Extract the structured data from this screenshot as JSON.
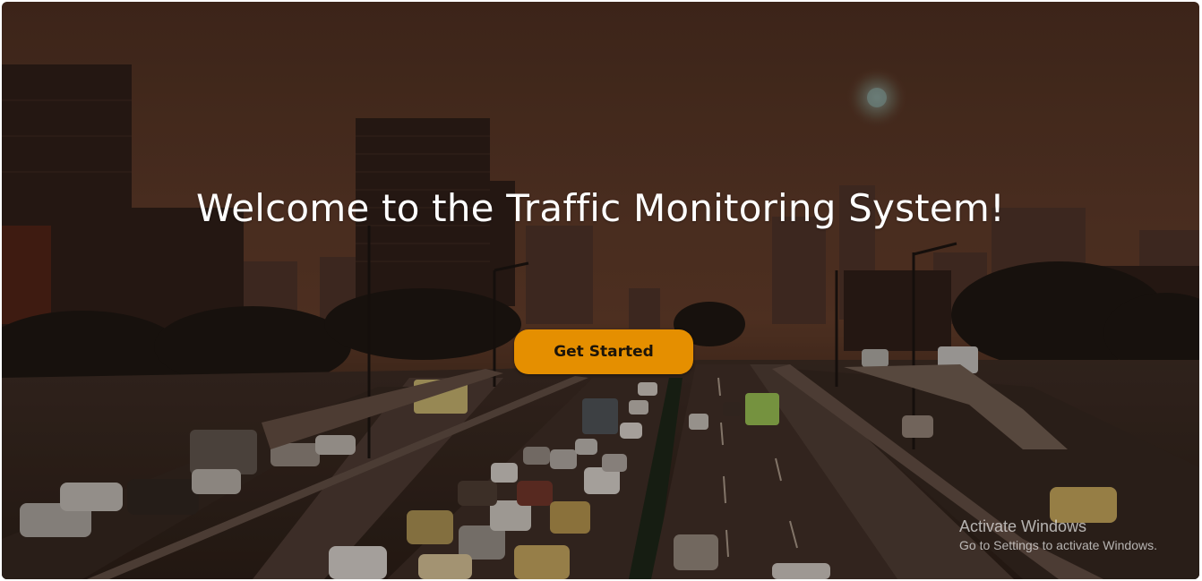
{
  "hero": {
    "title": "Welcome to the Traffic Monitoring System!",
    "cta_label": "Get Started"
  },
  "os_watermark": {
    "title": "Activate Windows",
    "subtitle": "Go to Settings to activate Windows."
  },
  "colors": {
    "cta_background": "#e58f00",
    "title_text": "#ffffff",
    "sky_tint": "#5e3a28"
  }
}
